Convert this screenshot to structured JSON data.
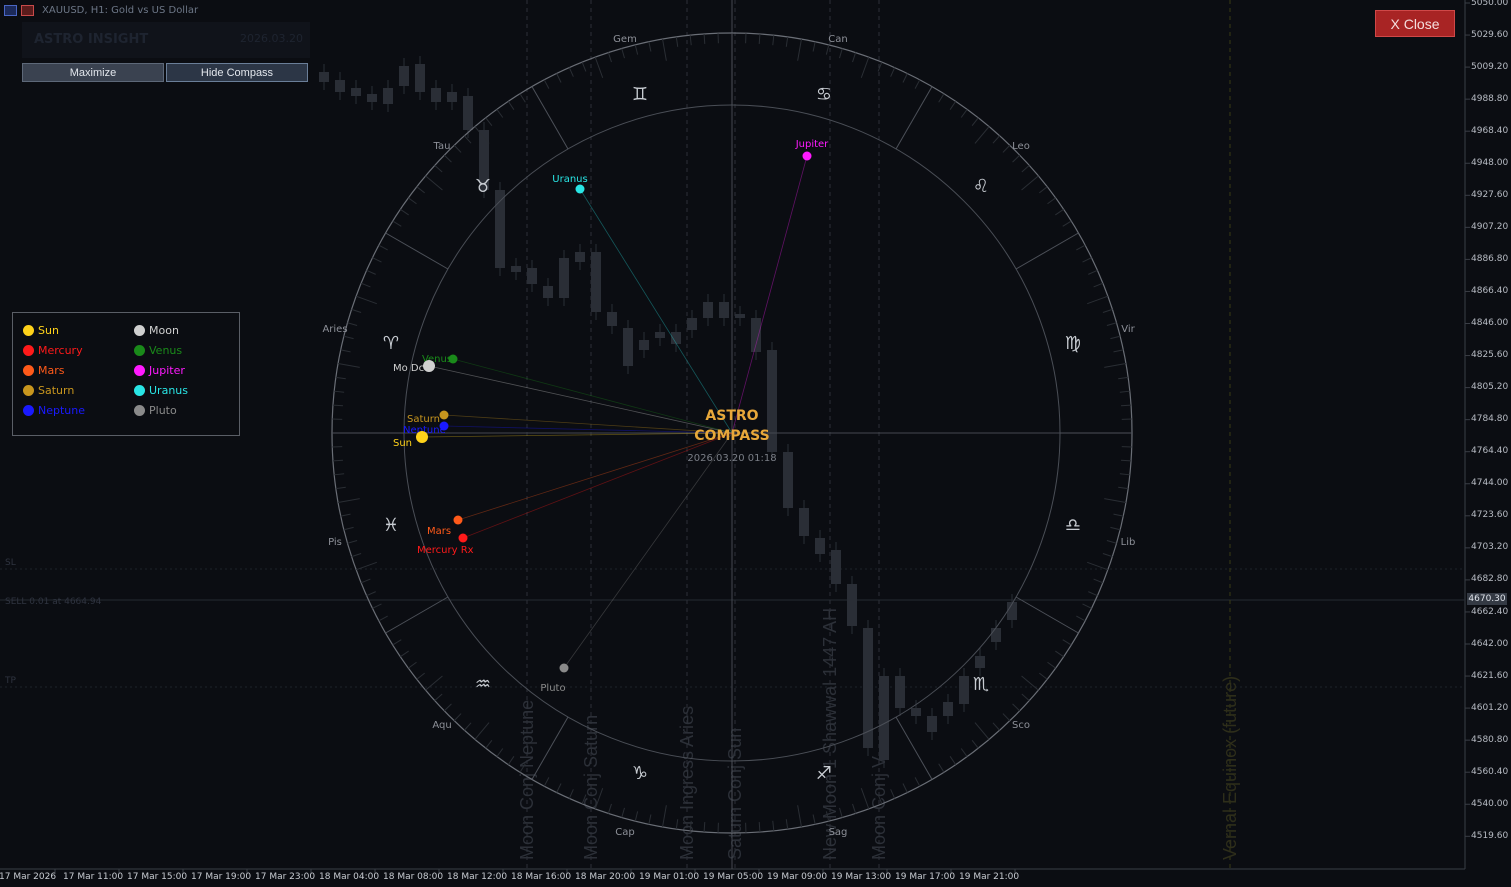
{
  "window": {
    "title": "XAUUSD, H1: Gold vs US Dollar"
  },
  "insight_panel": {
    "title": "ASTRO INSIGHT",
    "date": "2026.03.20"
  },
  "buttons": {
    "maximize": "Maximize",
    "hide_compass": "Hide Compass",
    "close": "X Close"
  },
  "compass": {
    "title_line1": "ASTRO",
    "title_line2": "COMPASS",
    "datetime": "2026.03.20 01:18",
    "sign_labels": [
      "Gem",
      "Can",
      "Tau",
      "Leo",
      "Aries",
      "Vir",
      "Pis",
      "Lib",
      "Aqu",
      "Sco",
      "Cap",
      "Sag"
    ],
    "sign_glyphs": [
      "♊",
      "♋",
      "♉",
      "♌",
      "♈",
      "♍",
      "♓",
      "♎",
      "♒",
      "♏",
      "♑",
      "♐"
    ]
  },
  "planets": [
    {
      "label": "Jupiter",
      "color": "#ff1aff"
    },
    {
      "label": "Uranus",
      "color": "#29e5e5"
    },
    {
      "label": "Venus",
      "color": "#1a8a1a"
    },
    {
      "label": "Mo Dc",
      "color": "#d0d0d0"
    },
    {
      "label": "Saturn",
      "color": "#c8961e"
    },
    {
      "label": "Neptune",
      "color": "#1a1aff"
    },
    {
      "label": "Sun",
      "color": "#ffd21a"
    },
    {
      "label": "Mars",
      "color": "#ff5a1a"
    },
    {
      "label": "Mercury Rx",
      "color": "#ff1a1a"
    },
    {
      "label": "Pluto",
      "color": "#8a8a8a"
    }
  ],
  "legend": [
    {
      "label": "Sun",
      "color": "#ffd21a"
    },
    {
      "label": "Moon",
      "color": "#d0d0d0"
    },
    {
      "label": "Mercury",
      "color": "#ff1a1a"
    },
    {
      "label": "Venus",
      "color": "#1a8a1a"
    },
    {
      "label": "Mars",
      "color": "#ff5a1a"
    },
    {
      "label": "Jupiter",
      "color": "#ff1aff"
    },
    {
      "label": "Saturn",
      "color": "#c8961e"
    },
    {
      "label": "Uranus",
      "color": "#29e5e5"
    },
    {
      "label": "Neptune",
      "color": "#1a1aff"
    },
    {
      "label": "Pluto",
      "color": "#8a8a8a"
    }
  ],
  "event_lines": [
    "Moon Conj Neptune",
    "Moon Conj Saturn",
    "Moon Ingress Aries",
    "Saturn Conj Sun",
    "New Moon 1 Shawwal 1447 AH",
    "Moon Conj V",
    "Vernal Equinox (future)"
  ],
  "hlines": {
    "sl": "SL",
    "sell": "SELL 0.01 at 4664.94",
    "tp": "TP"
  },
  "price_axis": [
    "5050.00",
    "5029.60",
    "5009.20",
    "4988.80",
    "4968.40",
    "4948.00",
    "4927.60",
    "4907.20",
    "4886.80",
    "4866.40",
    "4846.00",
    "4825.60",
    "4805.20",
    "4784.80",
    "4764.40",
    "4744.00",
    "4723.60",
    "4703.20",
    "4682.80",
    "4662.40",
    "4642.00",
    "4621.60",
    "4601.20",
    "4580.80",
    "4560.40",
    "4540.00",
    "4519.60"
  ],
  "current_price": "4670.30",
  "time_axis": [
    "17 Mar 2026",
    "17 Mar 11:00",
    "17 Mar 15:00",
    "17 Mar 19:00",
    "17 Mar 23:00",
    "18 Mar 04:00",
    "18 Mar 08:00",
    "18 Mar 12:00",
    "18 Mar 16:00",
    "18 Mar 20:00",
    "19 Mar 01:00",
    "19 Mar 05:00",
    "19 Mar 09:00",
    "19 Mar 13:00",
    "19 Mar 17:00",
    "19 Mar 21:00"
  ],
  "colors": {
    "background": "#0b0d12",
    "axis_text": "#b8bcc4",
    "close_button": "#a82424"
  }
}
